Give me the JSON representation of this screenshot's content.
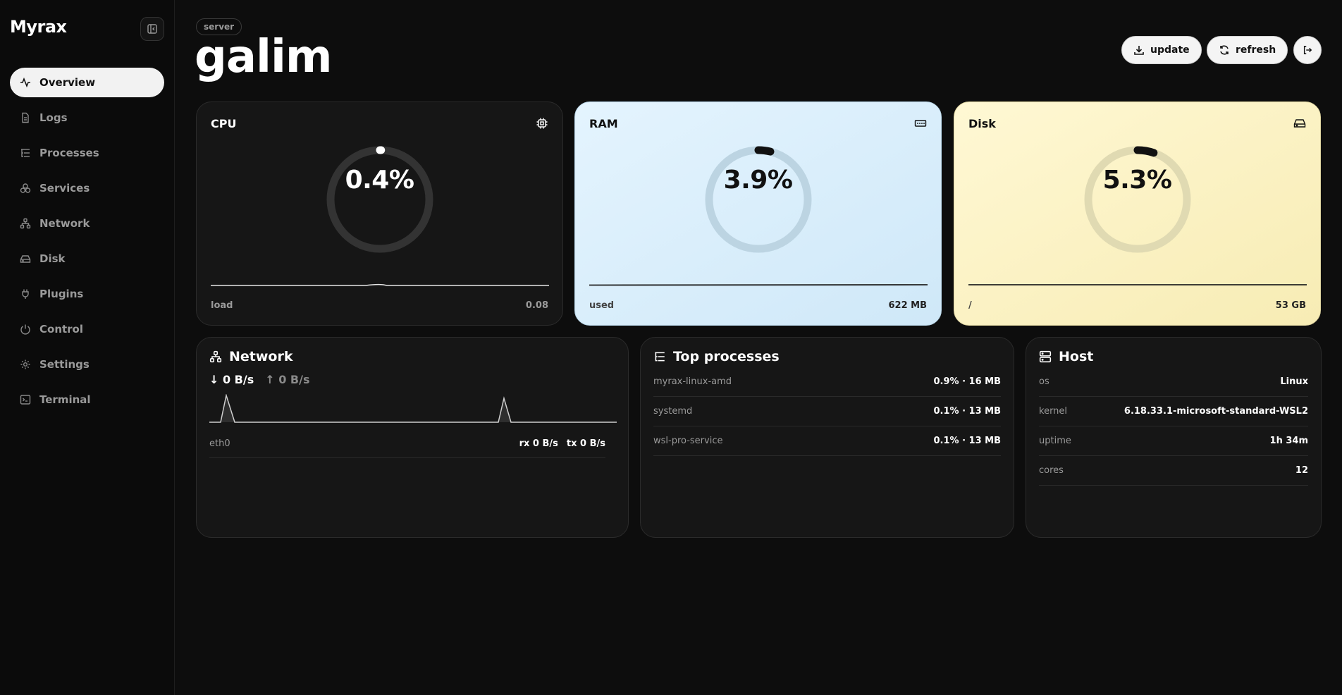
{
  "app": {
    "brand": "Myrax"
  },
  "sidebar": {
    "items": [
      {
        "label": "Overview",
        "icon": "activity-icon",
        "active": true
      },
      {
        "label": "Logs",
        "icon": "file-icon",
        "active": false
      },
      {
        "label": "Processes",
        "icon": "list-tree-icon",
        "active": false
      },
      {
        "label": "Services",
        "icon": "boxes-icon",
        "active": false
      },
      {
        "label": "Network",
        "icon": "network-icon",
        "active": false
      },
      {
        "label": "Disk",
        "icon": "hard-drive-icon",
        "active": false
      },
      {
        "label": "Plugins",
        "icon": "plug-icon",
        "active": false
      },
      {
        "label": "Control",
        "icon": "power-icon",
        "active": false
      },
      {
        "label": "Settings",
        "icon": "gear-icon",
        "active": false
      },
      {
        "label": "Terminal",
        "icon": "terminal-icon",
        "active": false
      }
    ]
  },
  "header": {
    "tag": "server",
    "title": "galim",
    "update_label": "update",
    "refresh_label": "refresh"
  },
  "stats": {
    "cpu": {
      "label": "CPU",
      "percent_text": "0.4%",
      "percent": 0.4,
      "foot_label": "load",
      "foot_value": "0.08"
    },
    "ram": {
      "label": "RAM",
      "percent_text": "3.9%",
      "percent": 3.9,
      "foot_label": "used",
      "foot_value": "622 MB"
    },
    "disk": {
      "label": "Disk",
      "percent_text": "5.3%",
      "percent": 5.3,
      "foot_label": "/",
      "foot_value": "53 GB"
    }
  },
  "network": {
    "title": "Network",
    "down": "↓ 0 B/s",
    "up": "↑ 0 B/s",
    "interfaces": [
      {
        "name": "eth0",
        "rx": "rx 0 B/s",
        "tx": "tx 0 B/s"
      }
    ]
  },
  "processes": {
    "title": "Top processes",
    "rows": [
      {
        "name": "myrax-linux-amd",
        "usage": "0.9% · 16 MB"
      },
      {
        "name": "systemd",
        "usage": "0.1% · 13 MB"
      },
      {
        "name": "wsl-pro-service",
        "usage": "0.1% · 13 MB"
      }
    ]
  },
  "host": {
    "title": "Host",
    "rows": [
      {
        "key": "os",
        "value": "Linux"
      },
      {
        "key": "kernel",
        "value": "6.18.33.1-microsoft-standard-WSL2"
      },
      {
        "key": "uptime",
        "value": "1h 34m"
      },
      {
        "key": "cores",
        "value": "12"
      }
    ]
  },
  "colors": {
    "background": "#0d0d0d",
    "ram_card": "#d8eefb",
    "disk_card": "#fbf2c4",
    "cpu_card": "#161616"
  }
}
